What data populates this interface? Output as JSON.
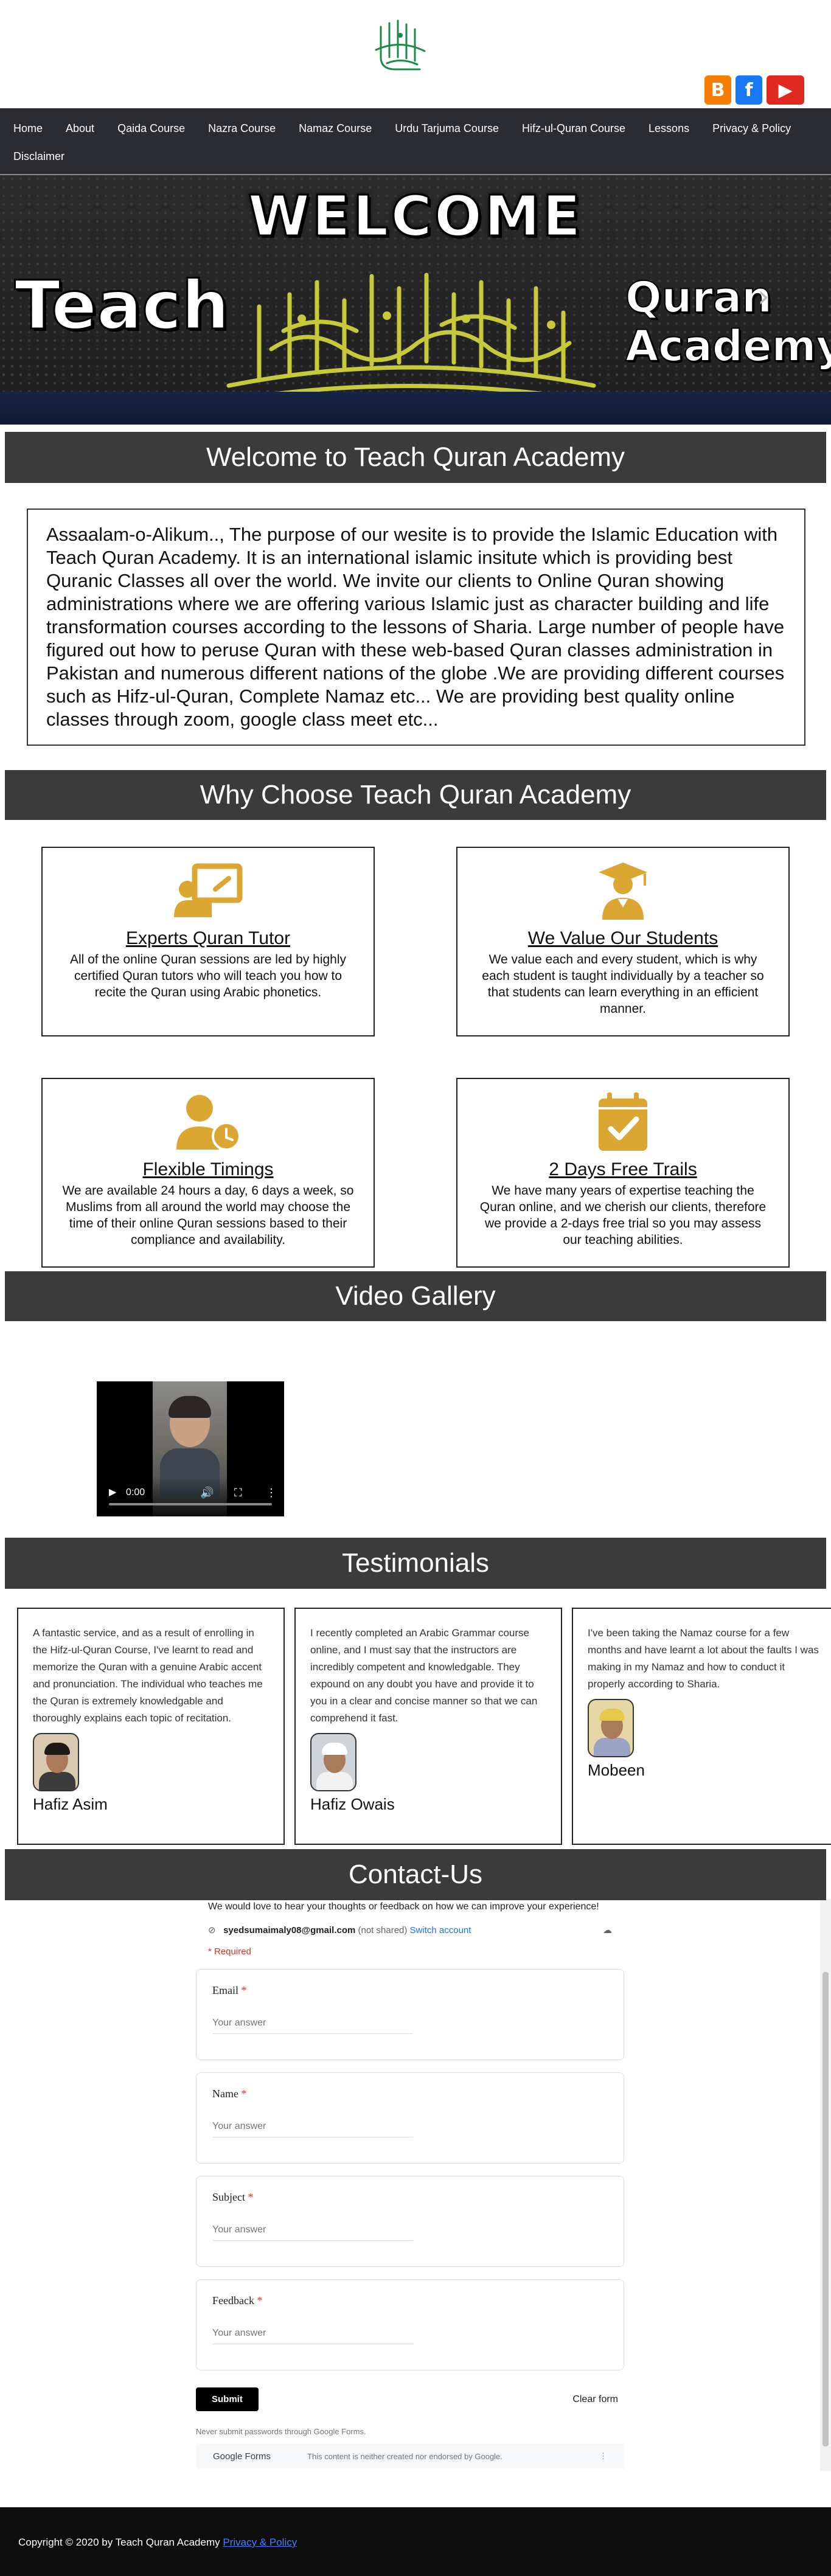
{
  "header": {
    "logo_icon": "bismillah-calligraphy-logo",
    "social": [
      {
        "name": "blogger",
        "icon": "blogger-icon",
        "glyph": "B",
        "color": "#f57d00"
      },
      {
        "name": "facebook",
        "icon": "facebook-icon",
        "glyph": "f",
        "color": "#1877f2"
      },
      {
        "name": "youtube",
        "icon": "youtube-icon",
        "glyph": "▶",
        "color": "#e02a20"
      }
    ]
  },
  "nav": {
    "items": [
      "Home",
      "About",
      "Qaida Course",
      "Nazra Course",
      "Namaz Course",
      "Urdu Tarjuma Course",
      "Hifz-ul-Quran Course",
      "Lessons",
      "Privacy & Policy",
      "Disclaimer"
    ]
  },
  "banner": {
    "welcome": "WELCOME",
    "teach": "Teach",
    "quran": "Quran",
    "academy": "Academy",
    "next_arrow": "›"
  },
  "welcome_section": {
    "heading": "Welcome to Teach Quran Academy",
    "text": "Assaalam-o-Alikum.., The purpose of our wesite is to provide the Islamic Education with Teach Quran Academy. It is an international islamic insitute which is providing best Quranic Classes all over the world. We invite our clients to Online Quran showing administrations where we are offering various Islamic just as character building and life transformation courses according to the lessons of Sharia. Large number of people have figured out how to peruse Quran with these web-based Quran classes administration in Pakistan and numerous different nations of the globe .We are providing different courses such as Hifz-ul-Quran, Complete Namaz etc... We are providing best quality online classes through zoom, google class meet etc..."
  },
  "why_section": {
    "heading": "Why Choose Teach Quran Academy",
    "accent_color": "#dba631",
    "cards": [
      {
        "icon": "teacher-board-icon",
        "title": "Experts Quran Tutor",
        "text": "All of the online Quran sessions are led by highly certified Quran tutors who will teach you how to recite the Quran using Arabic phonetics."
      },
      {
        "icon": "graduate-student-icon",
        "title": "We Value Our Students",
        "text": "We value each and every student, which is why each student is taught individually by a teacher so that students can learn everything in an efficient manner."
      },
      {
        "icon": "user-clock-icon",
        "title": "Flexible Timings",
        "text": "We are available 24 hours a day, 6 days a week, so Muslims from all around the world may choose the time of their online Quran sessions based to their compliance and availability."
      },
      {
        "icon": "calendar-check-icon",
        "title": "2 Days Free Trails",
        "text": "We have many years of expertise teaching the Quran online, and we cherish our clients, therefore we provide a 2-days free trial so you may assess our teaching abilities."
      }
    ]
  },
  "video_section": {
    "heading": "Video Gallery",
    "player": {
      "time": "0:00",
      "play_icon": "play-icon",
      "volume_icon": "volume-icon",
      "fullscreen_icon": "fullscreen-icon",
      "more_icon": "more-options-icon"
    }
  },
  "testimonials": {
    "heading": "Testimonials",
    "items": [
      {
        "text": "A fantastic service, and as a result of enrolling in the Hifz-ul-Quran Course, I've learnt to read and memorize the Quran with a genuine Arabic accent and pronunciation. The individual who teaches me the Quran is extremely knowledgable and thoroughly explains each topic of recitation.",
        "name": "Hafiz Asim"
      },
      {
        "text": "I recently completed an Arabic Grammar course online, and I must say that the instructors are incredibly competent and knowledgable. They expound on any doubt you have and provide it to you in a clear and concise manner so that we can comprehend it fast.",
        "name": "Hafiz Owais"
      },
      {
        "text": "I've been taking the Namaz course for a few months and have learnt a lot about the faults I was making in my Namaz and how to conduct it properly according to Sharia.",
        "name": "Mobeen"
      }
    ]
  },
  "contact": {
    "heading": "Contact-Us",
    "form": {
      "intro": "We would love to hear your thoughts or feedback on how we can improve your experience!",
      "account_email": "syedsumaimaly08@gmail.com",
      "not_shared": "(not shared)",
      "switch_account": "Switch account",
      "required_note": "* Required",
      "fields": [
        {
          "label": "Email",
          "placeholder": "Your answer"
        },
        {
          "label": "Name",
          "placeholder": "Your answer"
        },
        {
          "label": "Subject",
          "placeholder": "Your answer"
        },
        {
          "label": "Feedback",
          "placeholder": "Your answer"
        }
      ],
      "required_mark": "*",
      "submit": "Submit",
      "clear": "Clear form",
      "never_submit": "Never submit passwords through Google Forms.",
      "brand": "Google Forms",
      "disclaimer": "This content is neither created nor endorsed by Google.",
      "more": "⋮"
    }
  },
  "footer": {
    "copyright": "Copyright © 2020 by Teach Quran Academy",
    "link": "Privacy & Policy"
  }
}
